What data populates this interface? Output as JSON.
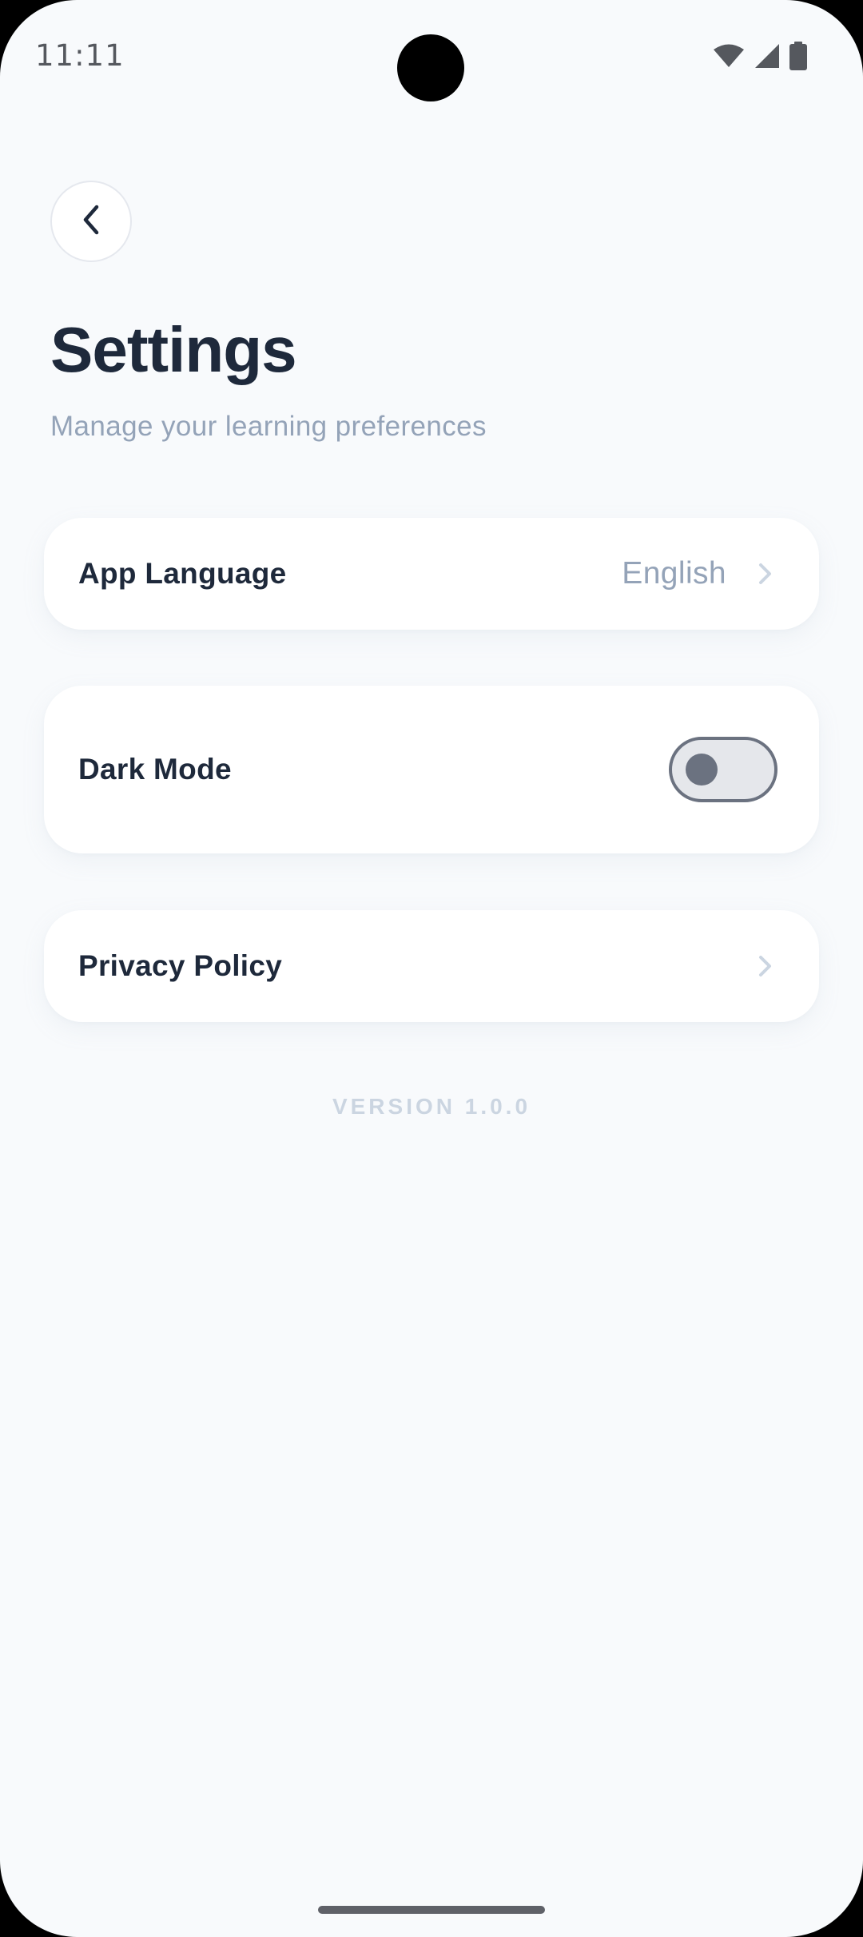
{
  "status_bar": {
    "time": "11:11",
    "icons": [
      "wifi-icon",
      "cellular-signal-icon",
      "battery-icon"
    ]
  },
  "header": {
    "back_icon": "chevron-left-icon",
    "title": "Settings",
    "subtitle": "Manage your learning preferences"
  },
  "settings": {
    "language": {
      "label": "App Language",
      "value": "English",
      "icon": "chevron-right-icon"
    },
    "dark_mode": {
      "label": "Dark Mode",
      "enabled": false
    },
    "privacy": {
      "label": "Privacy Policy",
      "icon": "chevron-right-icon"
    }
  },
  "footer": {
    "version": "VERSION 1.0.0"
  },
  "colors": {
    "background": "#F8FAFC",
    "card": "#FFFFFF",
    "title": "#1E293B",
    "muted": "#94A3B8",
    "version": "#CBD5E1",
    "toggle_off_track": "#E5E7EB",
    "toggle_off_knob": "#6B7280"
  }
}
